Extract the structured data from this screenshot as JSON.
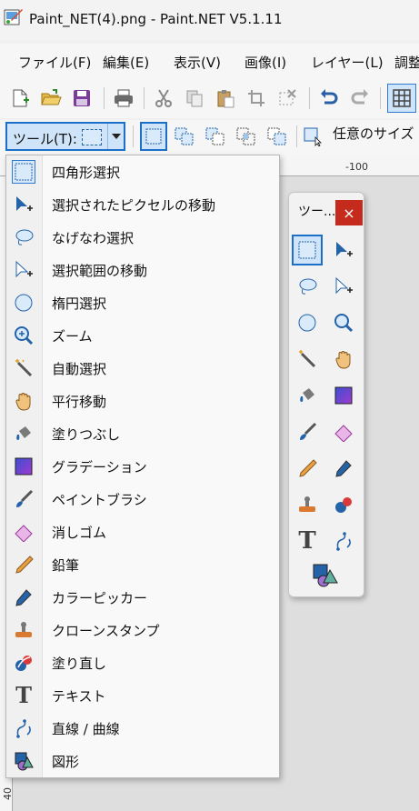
{
  "window": {
    "title": "Paint_NET(4).png - Paint.NET V5.1.11",
    "app_icon": "paintnet-app-icon"
  },
  "menubar": {
    "items": [
      "ファイル(F)",
      "編集(E)",
      "表示(V)",
      "画像(I)",
      "レイヤー(L)",
      "調整"
    ]
  },
  "toolbar": {
    "buttons": [
      "new-icon",
      "open-icon",
      "save-icon",
      "print-icon",
      "cut-icon",
      "copy-icon",
      "paste-icon",
      "crop-icon",
      "deselect-icon",
      "undo-icon",
      "redo-icon",
      "grid-icon"
    ]
  },
  "tool_options": {
    "tool_label": "ツール(T):",
    "selection_modes": [
      "replace-mode-icon",
      "union-mode-icon",
      "exclude-mode-icon",
      "intersect-mode-icon",
      "invert-mode-icon"
    ],
    "size_label": "任意のサイズ"
  },
  "ruler": {
    "h_label": "-100",
    "v_label": "40"
  },
  "tools_menu": {
    "items": [
      {
        "label": "四角形選択",
        "icon": "rectangle-select-icon",
        "selected": true
      },
      {
        "label": "選択されたピクセルの移動",
        "icon": "move-selected-icon"
      },
      {
        "label": "なげなわ選択",
        "icon": "lasso-select-icon"
      },
      {
        "label": "選択範囲の移動",
        "icon": "move-selection-icon"
      },
      {
        "label": "楕円選択",
        "icon": "ellipse-select-icon"
      },
      {
        "label": "ズーム",
        "icon": "zoom-icon"
      },
      {
        "label": "自動選択",
        "icon": "magic-wand-icon"
      },
      {
        "label": "平行移動",
        "icon": "pan-hand-icon"
      },
      {
        "label": "塗りつぶし",
        "icon": "paint-bucket-icon"
      },
      {
        "label": "グラデーション",
        "icon": "gradient-icon"
      },
      {
        "label": "ペイントブラシ",
        "icon": "paintbrush-icon"
      },
      {
        "label": "消しゴム",
        "icon": "eraser-icon"
      },
      {
        "label": "鉛筆",
        "icon": "pencil-icon"
      },
      {
        "label": "カラーピッカー",
        "icon": "color-picker-icon"
      },
      {
        "label": "クローンスタンプ",
        "icon": "clone-stamp-icon"
      },
      {
        "label": "塗り直し",
        "icon": "recolor-icon"
      },
      {
        "label": "テキスト",
        "icon": "text-icon"
      },
      {
        "label": "直線 / 曲線",
        "icon": "line-curve-icon"
      },
      {
        "label": "図形",
        "icon": "shapes-icon"
      }
    ]
  },
  "tools_palette": {
    "title": "ツー...",
    "close": "×"
  },
  "colors": {
    "accent": "#1b6fc7",
    "accent_bg": "#cfe4f8",
    "close_red": "#c42b1c"
  }
}
